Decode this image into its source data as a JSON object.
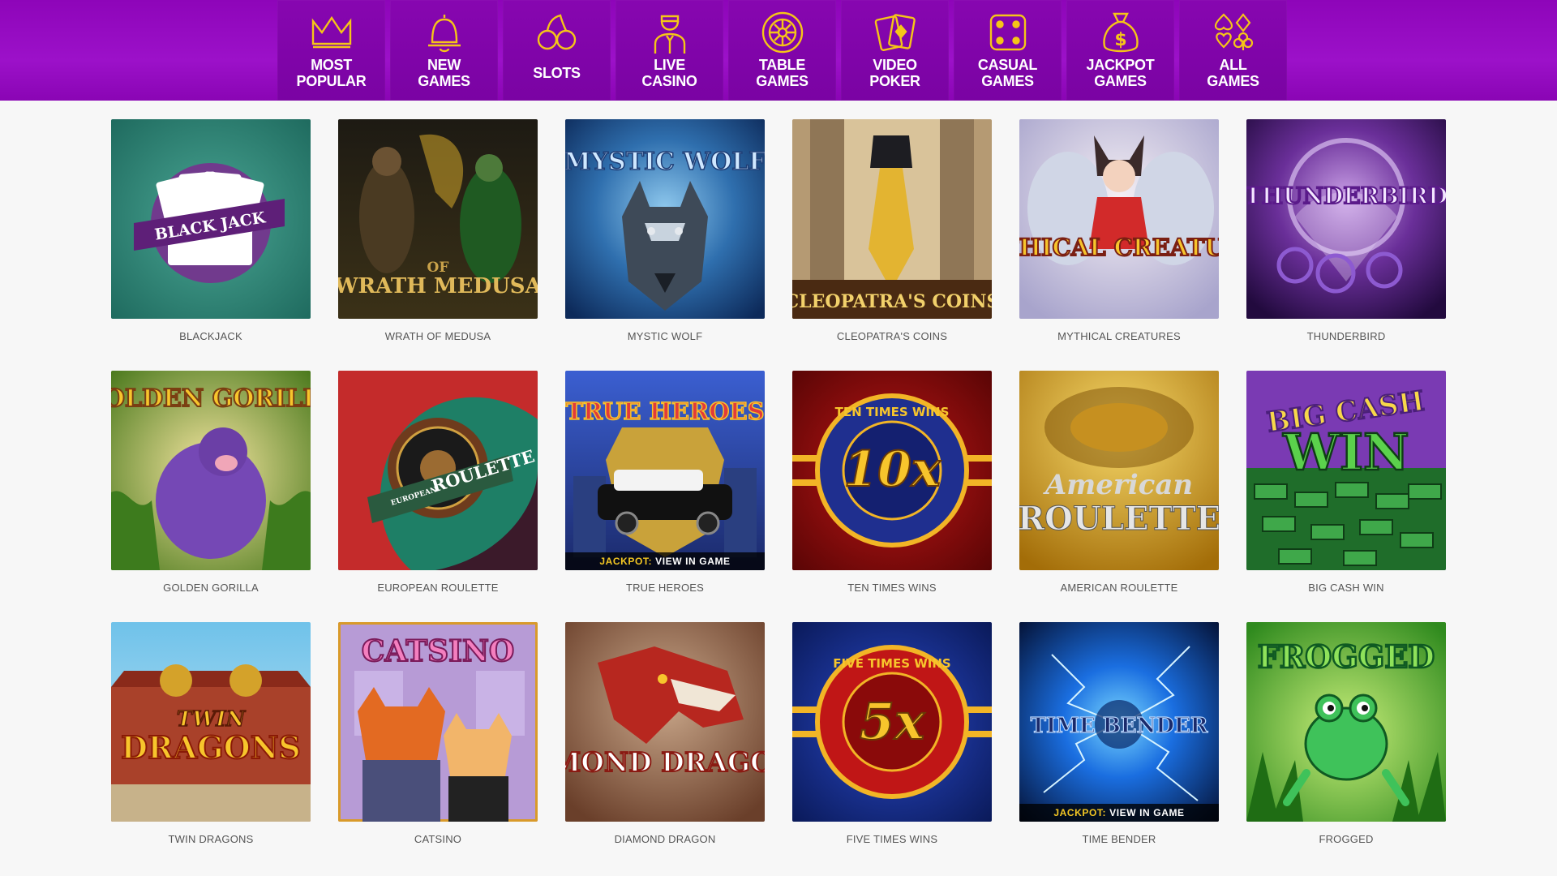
{
  "nav": {
    "items": [
      {
        "label": "MOST\nPOPULAR",
        "icon": "crown-icon"
      },
      {
        "label": "NEW\nGAMES",
        "icon": "bell-icon"
      },
      {
        "label": "SLOTS",
        "icon": "cherries-icon"
      },
      {
        "label": "LIVE\nCASINO",
        "icon": "dealer-icon"
      },
      {
        "label": "TABLE\nGAMES",
        "icon": "roulette-wheel-icon"
      },
      {
        "label": "VIDEO\nPOKER",
        "icon": "playing-cards-icon"
      },
      {
        "label": "CASUAL\nGAMES",
        "icon": "dice-icon"
      },
      {
        "label": "JACKPOT\nGAMES",
        "icon": "money-bag-icon"
      },
      {
        "label": "ALL\nGAMES",
        "icon": "card-suits-icon"
      }
    ],
    "icon_color": "#f5c518"
  },
  "games": [
    {
      "name": "BLACKJACK",
      "art_text": "BLACK JACK"
    },
    {
      "name": "WRATH OF MEDUSA",
      "art_text": "WRATH MEDUSA",
      "art_small": "OF"
    },
    {
      "name": "MYSTIC WOLF",
      "art_text": "MYSTIC WOLF"
    },
    {
      "name": "CLEOPATRA'S COINS",
      "art_text": "CLEOPATRA'S COINS"
    },
    {
      "name": "MYTHICAL CREATURES",
      "art_text": "MYTHICAL CREATURES"
    },
    {
      "name": "THUNDERBIRD",
      "art_text": "THUNDERBIRD"
    },
    {
      "name": "GOLDEN GORILLA",
      "art_text": "GOLDEN GORILLA"
    },
    {
      "name": "EUROPEAN ROULETTE",
      "art_text": "ROULETTE",
      "art_small": "EUROPEAN"
    },
    {
      "name": "TRUE HEROES",
      "art_text": "TRUE HEROES",
      "jackpot": "JACKPOT:",
      "jackpot_value": "VIEW IN GAME"
    },
    {
      "name": "TEN TIMES WINS",
      "art_text": "10x",
      "art_small": "TEN TIMES WINS"
    },
    {
      "name": "AMERICAN ROULETTE",
      "art_text": "ROULETTE",
      "art_small": "American"
    },
    {
      "name": "BIG CASH WIN",
      "art_text": "WIN",
      "art_small": "BIG CASH"
    },
    {
      "name": "TWIN DRAGONS",
      "art_text": "DRAGONS",
      "art_small": "TWIN"
    },
    {
      "name": "CATSINO",
      "art_text": "CATSINO"
    },
    {
      "name": "DIAMOND DRAGON",
      "art_text": "DIAMOND DRAGON"
    },
    {
      "name": "FIVE TIMES WINS",
      "art_text": "5x",
      "art_small": "FIVE TIMES WINS"
    },
    {
      "name": "TIME BENDER",
      "art_text": "TIME BENDER",
      "jackpot": "JACKPOT:",
      "jackpot_value": "VIEW IN GAME"
    },
    {
      "name": "FROGGED",
      "art_text": "FROGGED"
    }
  ]
}
